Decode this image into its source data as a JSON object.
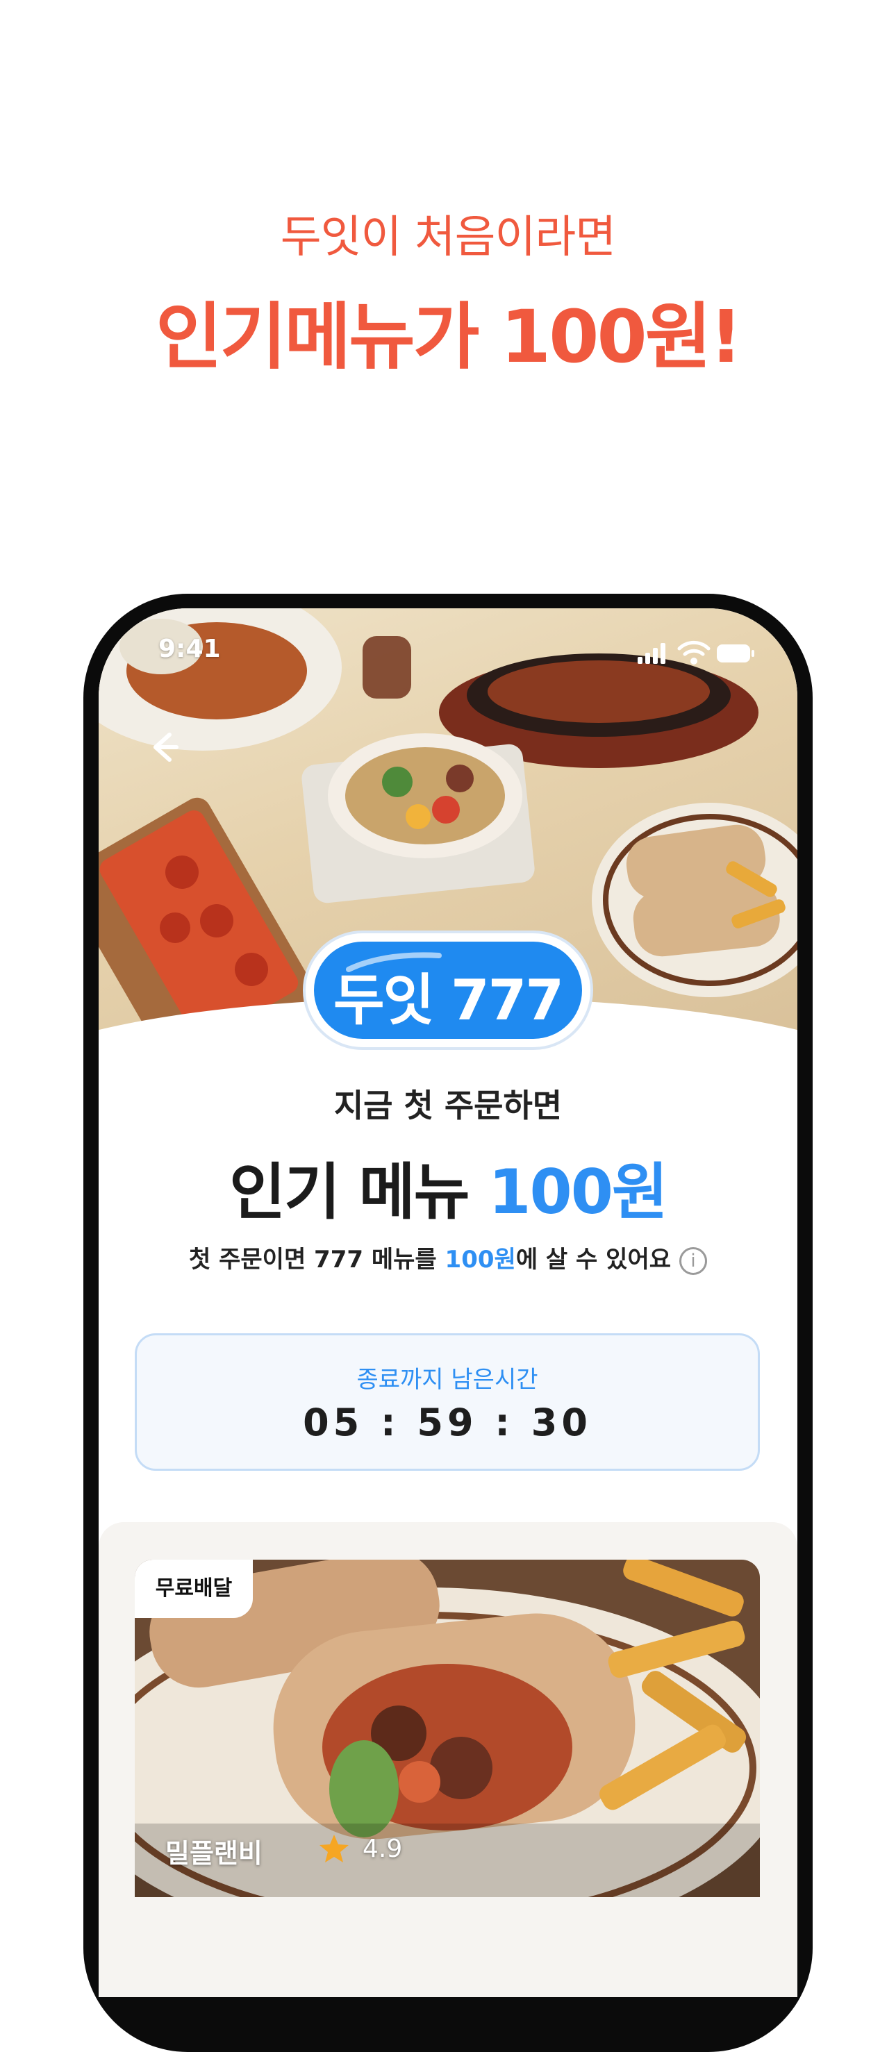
{
  "promo": {
    "subtitle": "두잇이 처음이라면",
    "title": "인기메뉴가 100원!"
  },
  "status_bar": {
    "time": "9:41",
    "icons": [
      "signal-icon",
      "wifi-icon",
      "battery-icon"
    ]
  },
  "hero": {
    "back_icon": "back-arrow-icon",
    "badge_text": "두잇 777"
  },
  "copy": {
    "sub": "지금 첫 주문하면",
    "main_prefix": "인기 메뉴 ",
    "main_highlight": "100원",
    "desc_prefix": "첫 주문이면 777 메뉴를 ",
    "desc_highlight": "100원",
    "desc_suffix": "에 살 수 있어요",
    "info_icon": "info-icon"
  },
  "timer": {
    "label": "종료까지 남은시간",
    "value": "05 : 59 : 30"
  },
  "card": {
    "badge": "무료배달",
    "shop_name": "밀플랜비",
    "rating": "4.9",
    "star_icon": "star-icon"
  },
  "colors": {
    "promo_accent": "#f0593e",
    "blue_accent": "#2e8ff3",
    "star": "#f6a623"
  }
}
